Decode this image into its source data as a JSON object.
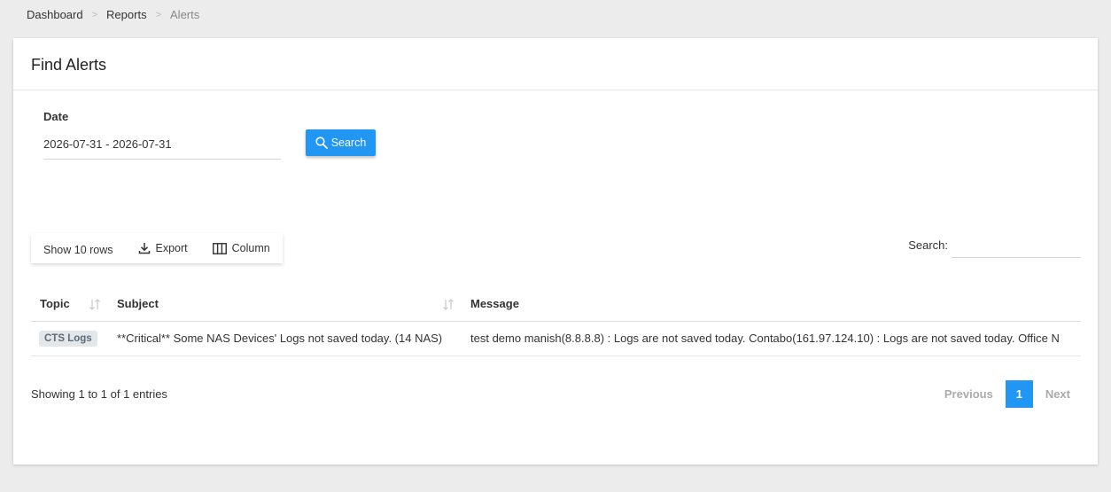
{
  "breadcrumb": {
    "items": [
      "Dashboard",
      "Reports",
      "Alerts"
    ],
    "separator": ">"
  },
  "card": {
    "title": "Find Alerts"
  },
  "filter": {
    "date_label": "Date",
    "date_value": "2026-07-31 - 2026-07-31",
    "search_button": "Search"
  },
  "toolbar": {
    "show_rows": "Show 10 rows",
    "export": "Export",
    "column": "Column"
  },
  "table_search": {
    "label": "Search:",
    "value": ""
  },
  "table": {
    "headers": [
      "Topic",
      "Subject",
      "Message"
    ],
    "rows": [
      {
        "topic": "CTS Logs",
        "subject": "**Critical** Some NAS Devices' Logs not saved today. (14 NAS)",
        "message": "test demo manish(8.8.8.8) : Logs are not saved today. Contabo(161.97.124.10) : Logs are not saved today. Office N"
      }
    ]
  },
  "footer": {
    "info": "Showing 1 to 1 of 1 entries",
    "previous": "Previous",
    "current_page": "1",
    "next": "Next"
  },
  "colors": {
    "accent": "#2196f3",
    "badge_bg": "#e3e7ea",
    "background": "#ececec"
  }
}
